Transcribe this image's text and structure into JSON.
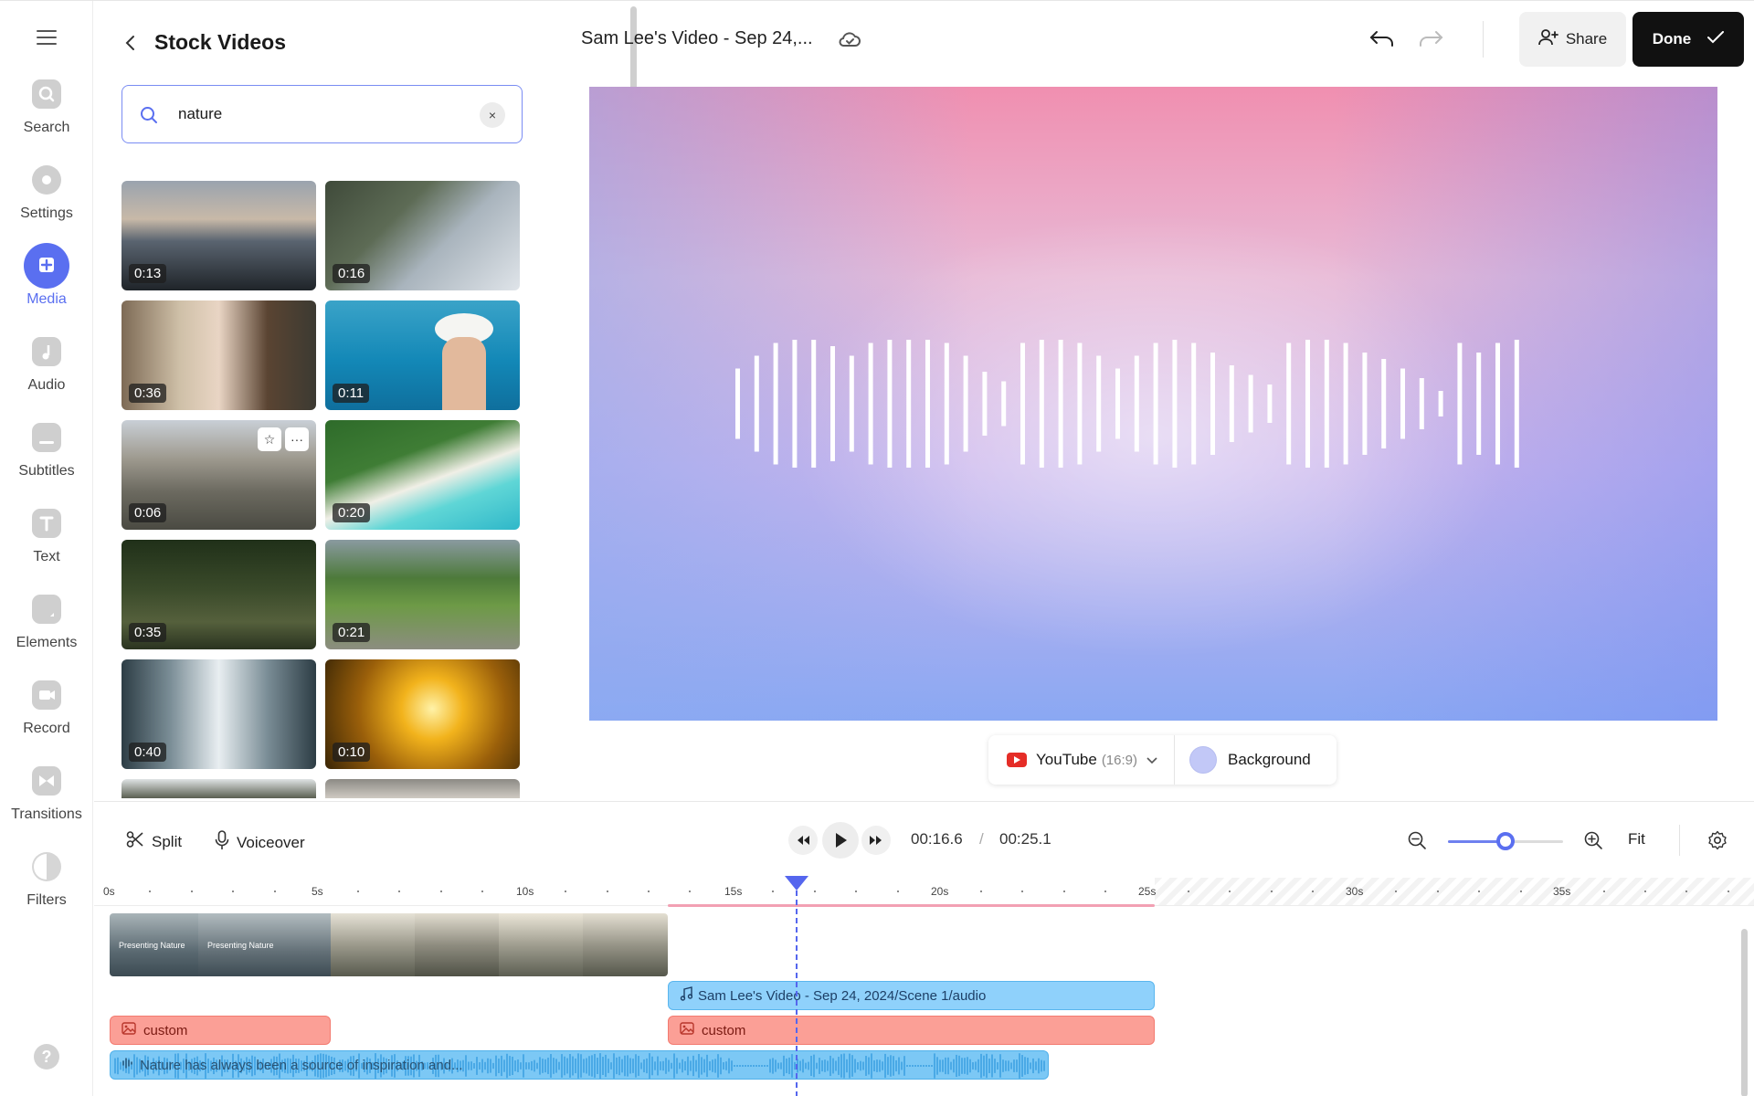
{
  "rail": {
    "items": [
      {
        "label": "Search",
        "icon": "search-icon"
      },
      {
        "label": "Settings",
        "icon": "settings-icon"
      },
      {
        "label": "Media",
        "icon": "plus-icon",
        "active": true
      },
      {
        "label": "Audio",
        "icon": "music-note-icon"
      },
      {
        "label": "Subtitles",
        "icon": "subtitles-icon"
      },
      {
        "label": "Text",
        "icon": "text-icon"
      },
      {
        "label": "Elements",
        "icon": "elements-icon"
      },
      {
        "label": "Record",
        "icon": "camera-icon"
      },
      {
        "label": "Transitions",
        "icon": "transitions-icon"
      },
      {
        "label": "Filters",
        "icon": "filters-icon"
      }
    ],
    "help": "?"
  },
  "panel": {
    "title": "Stock Videos",
    "search_value": "nature",
    "clear_label": "×",
    "thumbnails": [
      {
        "duration": "0:13",
        "scene": "mountain lake at dusk"
      },
      {
        "duration": "0:16",
        "scene": "rocky lakeshore with pines"
      },
      {
        "duration": "0:36",
        "scene": "woman with eyes closed by tree"
      },
      {
        "duration": "0:11",
        "scene": "woman in sun hat drinking coconut by sea"
      },
      {
        "duration": "0:06",
        "scene": "canyon cliffs"
      },
      {
        "duration": "0:20",
        "scene": "aerial turquoise coastline"
      },
      {
        "duration": "0:35",
        "scene": "dark forest with fallen trunk"
      },
      {
        "duration": "0:21",
        "scene": "green cliffs with trees"
      },
      {
        "duration": "0:40",
        "scene": "snowy forest path"
      },
      {
        "duration": "0:10",
        "scene": "golden sunlight through forest"
      }
    ]
  },
  "header": {
    "project_title": "Sam Lee's Video - Sep 24,...",
    "share_label": "Share",
    "done_label": "Done"
  },
  "format_bar": {
    "platform": "YouTube",
    "ratio": "(16:9)",
    "background_label": "Background",
    "background_color": "#c2c8f7"
  },
  "timeline": {
    "split_label": "Split",
    "voiceover_label": "Voiceover",
    "current_time": "00:16.6",
    "separator": "/",
    "total_time": "00:25.1",
    "fit_label": "Fit",
    "zoom_level": 0.5,
    "ruler_ticks": [
      "0s",
      "5s",
      "10s",
      "15s",
      "20s",
      "25s",
      "30s",
      "35s"
    ],
    "video_clip_caption": "Presenting Nature",
    "audio_track_label": "Sam Lee's Video - Sep 24, 2024/Scene 1/audio",
    "custom_label": "custom",
    "voiceover_text": "Nature has always been a source of inspiration and..."
  },
  "colors": {
    "accent": "#5a6ff0",
    "done_bg": "#111111",
    "audio_bar": "#8fd1fb",
    "custom_bar": "#fb9f96"
  }
}
